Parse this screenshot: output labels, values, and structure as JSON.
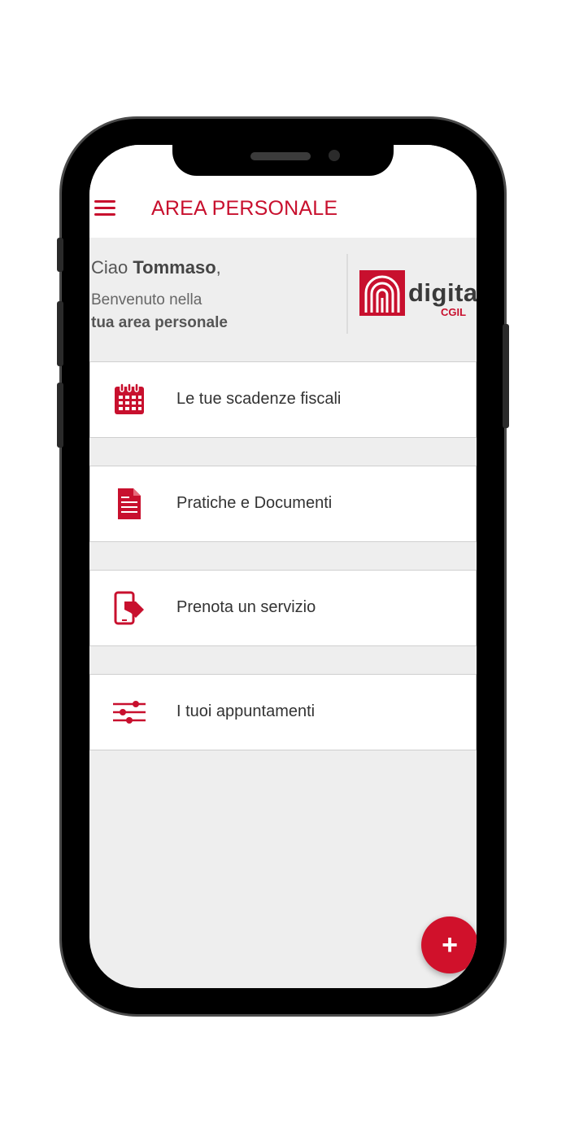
{
  "app_bar": {
    "title": "AREA PERSONALE"
  },
  "welcome": {
    "greeting_prefix": "Ciao ",
    "user_name": "Tommaso",
    "greeting_suffix": ",",
    "line1": "Benvenuto nella",
    "line2": "tua area personale"
  },
  "logo": {
    "word": "digita",
    "sub": "CGIL"
  },
  "menu_items": [
    {
      "label": "Le tue scadenze fiscali",
      "icon": "calendar-icon"
    },
    {
      "label": "Pratiche e Documenti",
      "icon": "document-icon"
    },
    {
      "label": "Prenota un servizio",
      "icon": "phone-tap-icon"
    },
    {
      "label": "I tuoi appuntamenti",
      "icon": "sliders-icon"
    }
  ],
  "fab": {
    "label": "+"
  },
  "colors": {
    "accent": "#c8102e",
    "background": "#eeeeee",
    "card": "#ffffff"
  }
}
